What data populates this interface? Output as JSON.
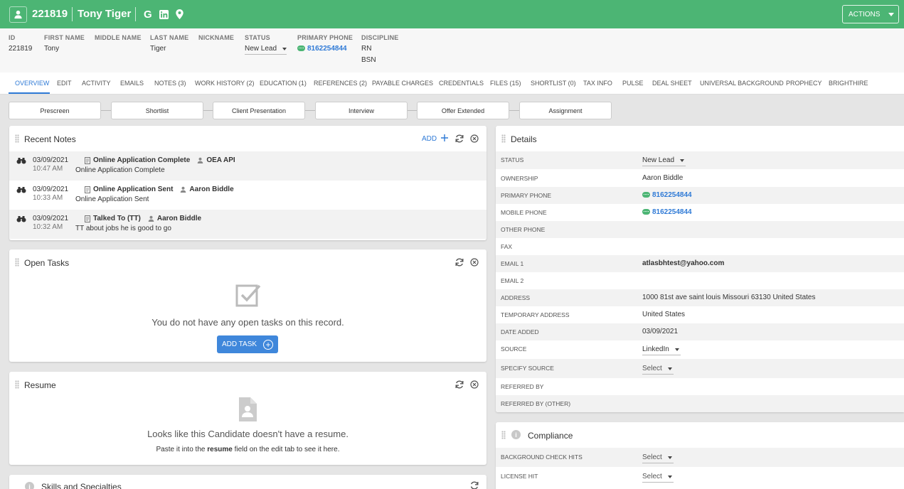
{
  "header": {
    "record_id": "221819",
    "record_name": "Tony Tiger",
    "google_icon": "G",
    "actions_label": "ACTIONS"
  },
  "info": {
    "fields": [
      {
        "label": "ID",
        "value": "221819"
      },
      {
        "label": "FIRST NAME",
        "value": "Tony"
      },
      {
        "label": "MIDDLE NAME",
        "value": ""
      },
      {
        "label": "LAST NAME",
        "value": "Tiger"
      },
      {
        "label": "NICKNAME",
        "value": ""
      },
      {
        "label": "STATUS",
        "value": "New Lead"
      },
      {
        "label": "PRIMARY PHONE",
        "value": "8162254844"
      },
      {
        "label": "DISCIPLINE",
        "value": "RN",
        "value2": "BSN"
      }
    ]
  },
  "tabs": [
    "OVERVIEW",
    "EDIT",
    "ACTIVITY",
    "EMAILS",
    "NOTES (3)",
    "WORK HISTORY (2)",
    "EDUCATION (1)",
    "REFERENCES (2)",
    "PAYABLE CHARGES",
    "CREDENTIALS",
    "FILES (15)",
    "SHORTLIST (0)",
    "TAX INFO",
    "PULSE",
    "DEAL SHEET",
    "UNIVERSAL BACKGROUND",
    "PROPHECY",
    "BRIGHTHIRE"
  ],
  "stages": [
    "Prescreen",
    "Shortlist",
    "Client Presentation",
    "Interview",
    "Offer Extended",
    "Assignment"
  ],
  "recent_notes": {
    "title": "Recent Notes",
    "add_label": "ADD",
    "items": [
      {
        "date": "03/09/2021",
        "time": "10:47 AM",
        "type": "Online Application Complete",
        "user": "OEA API",
        "text": "Online Application Complete"
      },
      {
        "date": "03/09/2021",
        "time": "10:33 AM",
        "type": "Online Application Sent",
        "user": "Aaron Biddle",
        "text": "Online Application Sent"
      },
      {
        "date": "03/09/2021",
        "time": "10:32 AM",
        "type": "Talked To (TT)",
        "user": "Aaron Biddle",
        "text": "TT about jobs he is good to go"
      }
    ]
  },
  "open_tasks": {
    "title": "Open Tasks",
    "empty_text": "You do not have any open tasks on this record.",
    "add_task_label": "ADD TASK"
  },
  "resume": {
    "title": "Resume",
    "empty_text": "Looks like this Candidate doesn't have a resume.",
    "paste_prefix": "Paste it into the ",
    "paste_bold": "resume",
    "paste_suffix": " field on the edit tab to see it here."
  },
  "skills": {
    "title": "Skills and Specialties"
  },
  "details": {
    "title": "Details",
    "rows": [
      {
        "label": "STATUS",
        "value": "New Lead"
      },
      {
        "label": "OWNERSHIP",
        "value": "Aaron Biddle"
      },
      {
        "label": "PRIMARY PHONE",
        "value": "8162254844"
      },
      {
        "label": "MOBILE PHONE",
        "value": "8162254844"
      },
      {
        "label": "OTHER PHONE",
        "value": ""
      },
      {
        "label": "FAX",
        "value": ""
      },
      {
        "label": "EMAIL 1",
        "value": "atlasbhtest@yahoo.com"
      },
      {
        "label": "EMAIL 2",
        "value": ""
      },
      {
        "label": "ADDRESS",
        "value": "1000 81st ave saint louis Missouri 63130 United States"
      },
      {
        "label": "TEMPORARY ADDRESS",
        "value": "United States"
      },
      {
        "label": "DATE ADDED",
        "value": "03/09/2021"
      },
      {
        "label": "SOURCE",
        "value": "LinkedIn"
      },
      {
        "label": "SPECIFY SOURCE",
        "value": "Select"
      },
      {
        "label": "REFERRED BY",
        "value": ""
      },
      {
        "label": "REFERRED BY (OTHER)",
        "value": ""
      }
    ]
  },
  "compliance": {
    "title": "Compliance",
    "rows": [
      {
        "label": "BACKGROUND CHECK HITS",
        "value": "Select"
      },
      {
        "label": "LICENSE HIT",
        "value": "Select"
      }
    ]
  },
  "colors": {
    "brand_green": "#4cb574",
    "accent_blue": "#2f7ad6",
    "button_blue": "#3f87db"
  }
}
